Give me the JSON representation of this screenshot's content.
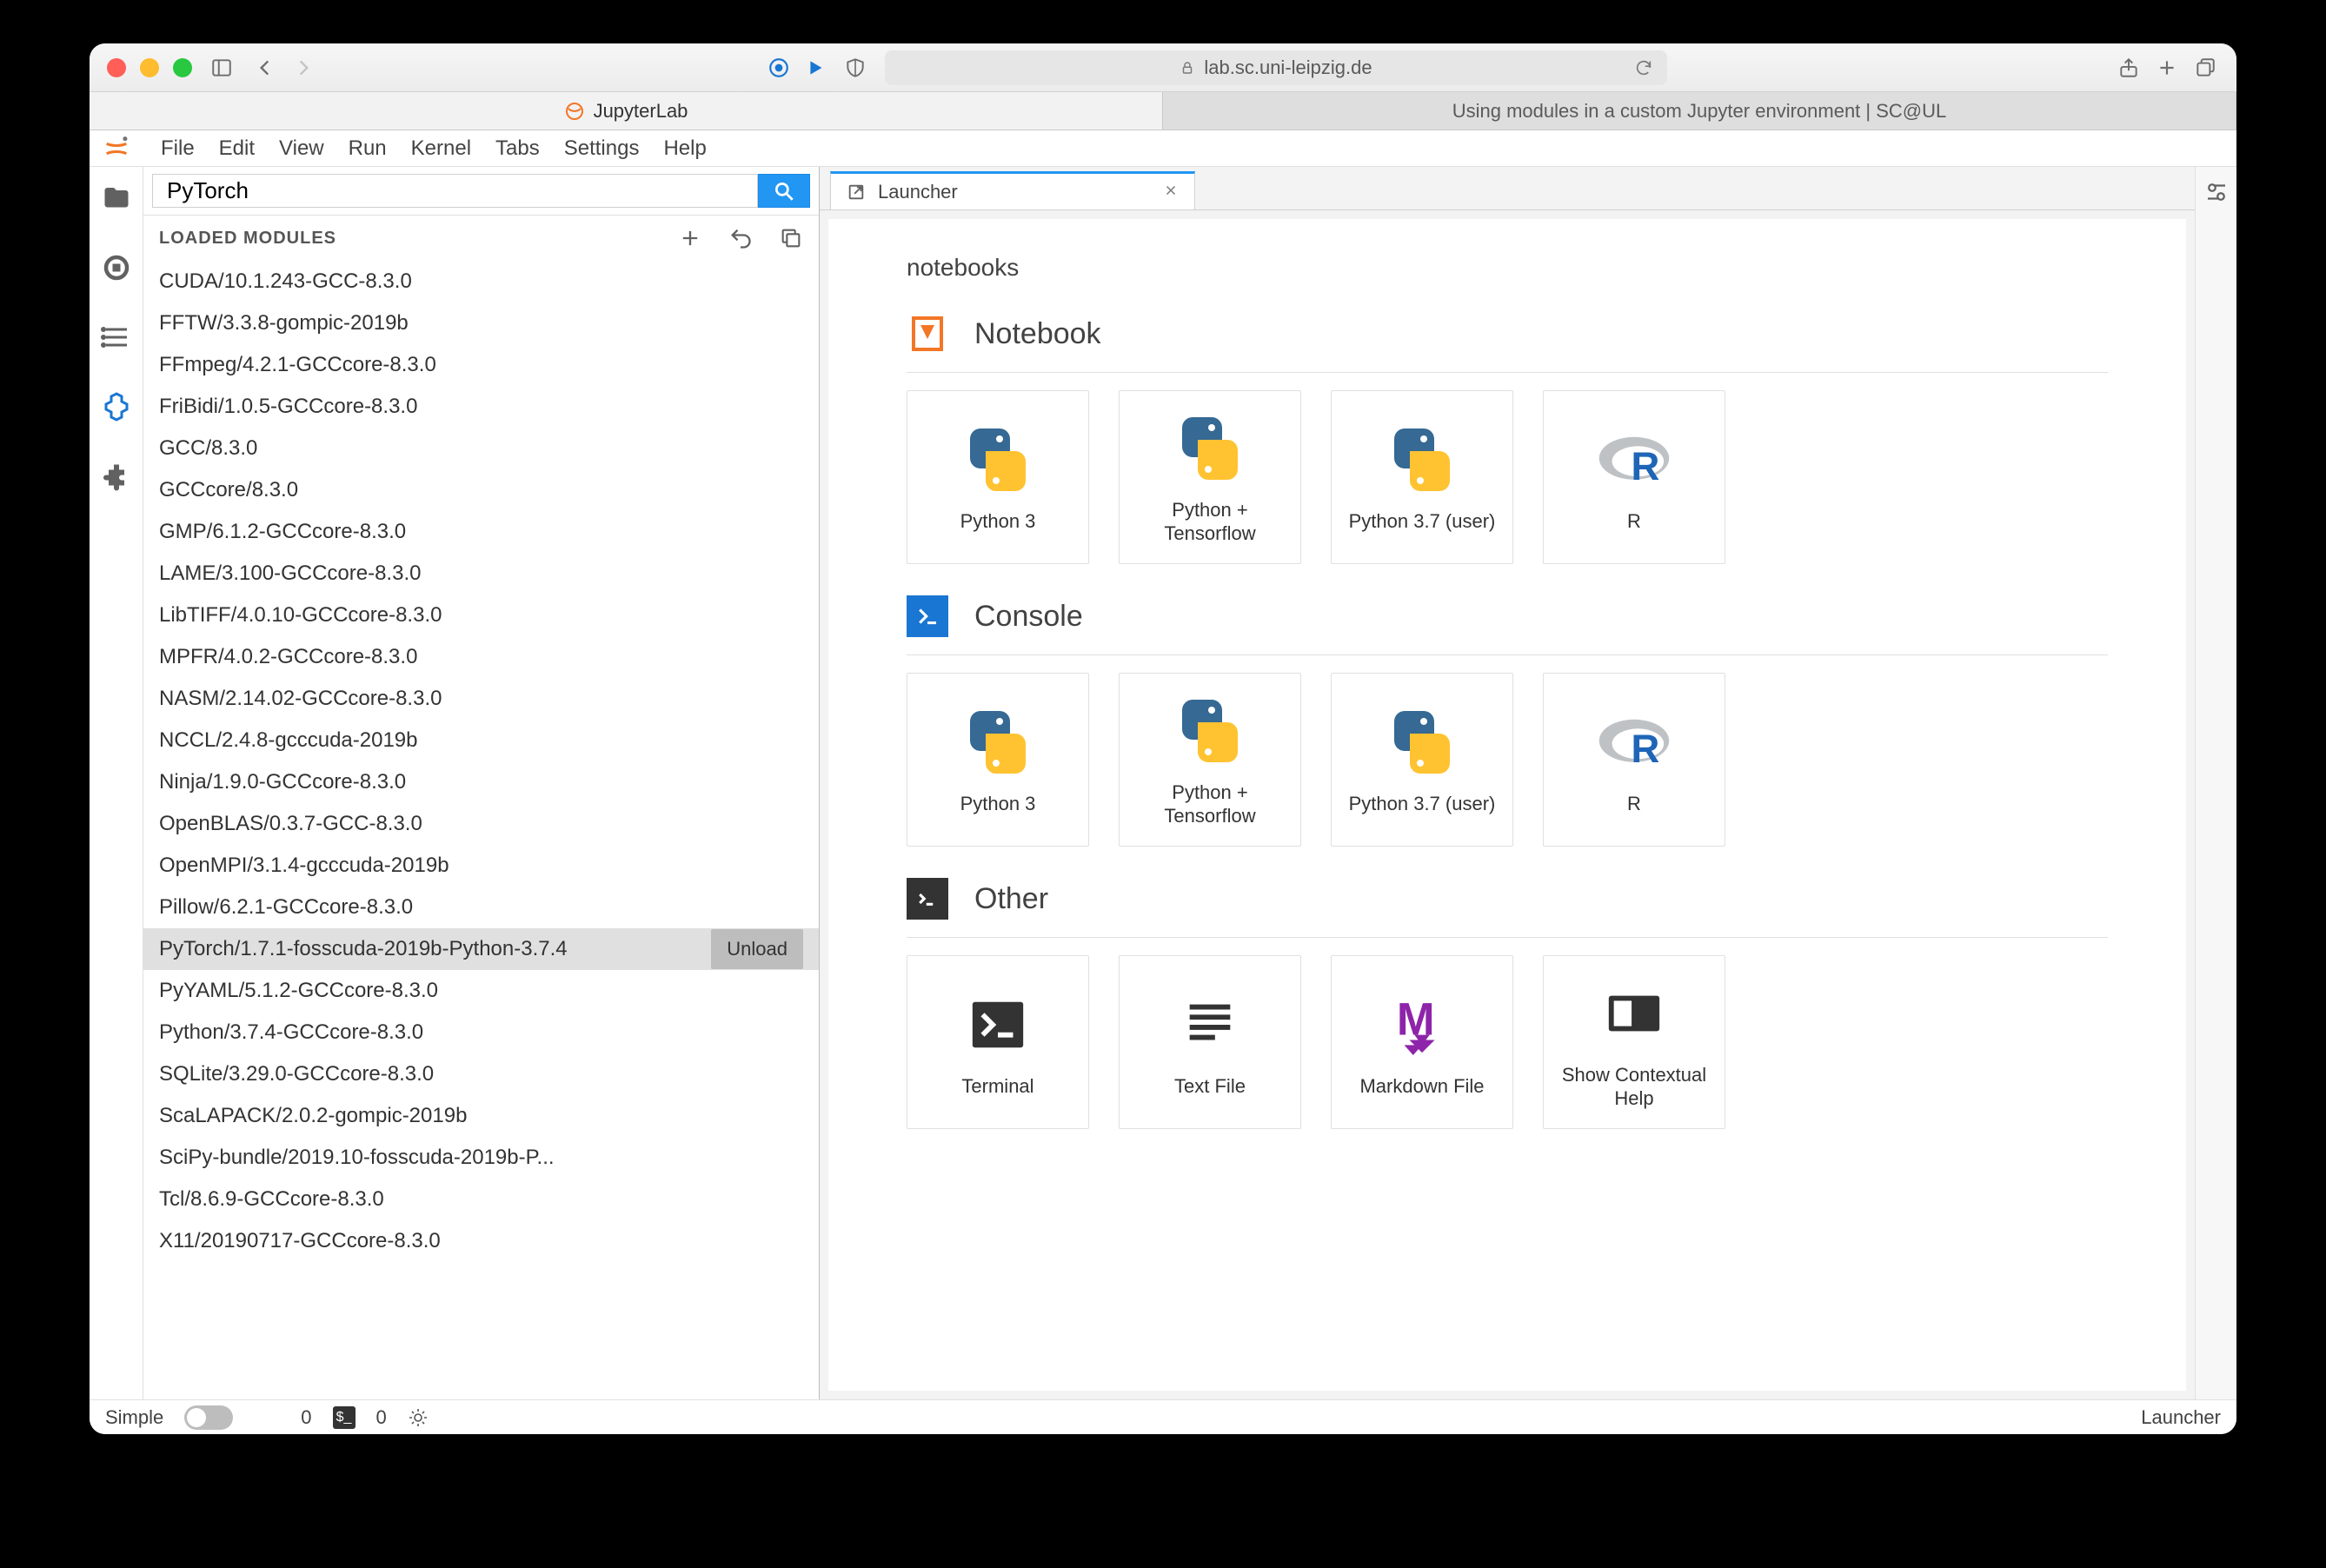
{
  "browser": {
    "url_display": "lab.sc.uni-leipzig.de",
    "tabs": [
      {
        "label": "JupyterLab",
        "active": true
      },
      {
        "label": "Using modules in a custom Jupyter environment | SC@UL",
        "active": false
      }
    ]
  },
  "menubar": {
    "items": [
      "File",
      "Edit",
      "View",
      "Run",
      "Kernel",
      "Tabs",
      "Settings",
      "Help"
    ]
  },
  "sidepanel": {
    "search_value": "PyTorch",
    "header": "LOADED MODULES",
    "modules": [
      {
        "name": "CUDA/10.1.243-GCC-8.3.0"
      },
      {
        "name": "FFTW/3.3.8-gompic-2019b"
      },
      {
        "name": "FFmpeg/4.2.1-GCCcore-8.3.0"
      },
      {
        "name": "FriBidi/1.0.5-GCCcore-8.3.0"
      },
      {
        "name": "GCC/8.3.0"
      },
      {
        "name": "GCCcore/8.3.0"
      },
      {
        "name": "GMP/6.1.2-GCCcore-8.3.0"
      },
      {
        "name": "LAME/3.100-GCCcore-8.3.0"
      },
      {
        "name": "LibTIFF/4.0.10-GCCcore-8.3.0"
      },
      {
        "name": "MPFR/4.0.2-GCCcore-8.3.0"
      },
      {
        "name": "NASM/2.14.02-GCCcore-8.3.0"
      },
      {
        "name": "NCCL/2.4.8-gcccuda-2019b"
      },
      {
        "name": "Ninja/1.9.0-GCCcore-8.3.0"
      },
      {
        "name": "OpenBLAS/0.3.7-GCC-8.3.0"
      },
      {
        "name": "OpenMPI/3.1.4-gcccuda-2019b"
      },
      {
        "name": "Pillow/6.2.1-GCCcore-8.3.0"
      },
      {
        "name": "PyTorch/1.7.1-fosscuda-2019b-Python-3.7.4",
        "selected": true,
        "action_label": "Unload"
      },
      {
        "name": "PyYAML/5.1.2-GCCcore-8.3.0"
      },
      {
        "name": "Python/3.7.4-GCCcore-8.3.0"
      },
      {
        "name": "SQLite/3.29.0-GCCcore-8.3.0"
      },
      {
        "name": "ScaLAPACK/2.0.2-gompic-2019b"
      },
      {
        "name": "SciPy-bundle/2019.10-fosscuda-2019b-P..."
      },
      {
        "name": "Tcl/8.6.9-GCCcore-8.3.0"
      },
      {
        "name": "X11/20190717-GCCcore-8.3.0"
      }
    ]
  },
  "dock": {
    "tab_label": "Launcher",
    "path": "notebooks",
    "sections": {
      "notebook": {
        "title": "Notebook",
        "icon_color": "#f37626",
        "cards": [
          {
            "label": "Python 3",
            "icon": "python"
          },
          {
            "label": "Python + Tensorflow",
            "icon": "python"
          },
          {
            "label": "Python 3.7 (user)",
            "icon": "python"
          },
          {
            "label": "R",
            "icon": "r"
          }
        ]
      },
      "console": {
        "title": "Console",
        "icon_color": "#1976d2",
        "cards": [
          {
            "label": "Python 3",
            "icon": "python"
          },
          {
            "label": "Python + Tensorflow",
            "icon": "python"
          },
          {
            "label": "Python 3.7 (user)",
            "icon": "python"
          },
          {
            "label": "R",
            "icon": "r"
          }
        ]
      },
      "other": {
        "title": "Other",
        "icon_color": "#333",
        "cards": [
          {
            "label": "Terminal",
            "icon": "terminal"
          },
          {
            "label": "Text File",
            "icon": "textfile"
          },
          {
            "label": "Markdown File",
            "icon": "markdown"
          },
          {
            "label": "Show Contextual Help",
            "icon": "help"
          }
        ]
      }
    }
  },
  "statusbar": {
    "simple_label": "Simple",
    "counter1": "0",
    "counter2": "0",
    "context": "Launcher"
  }
}
